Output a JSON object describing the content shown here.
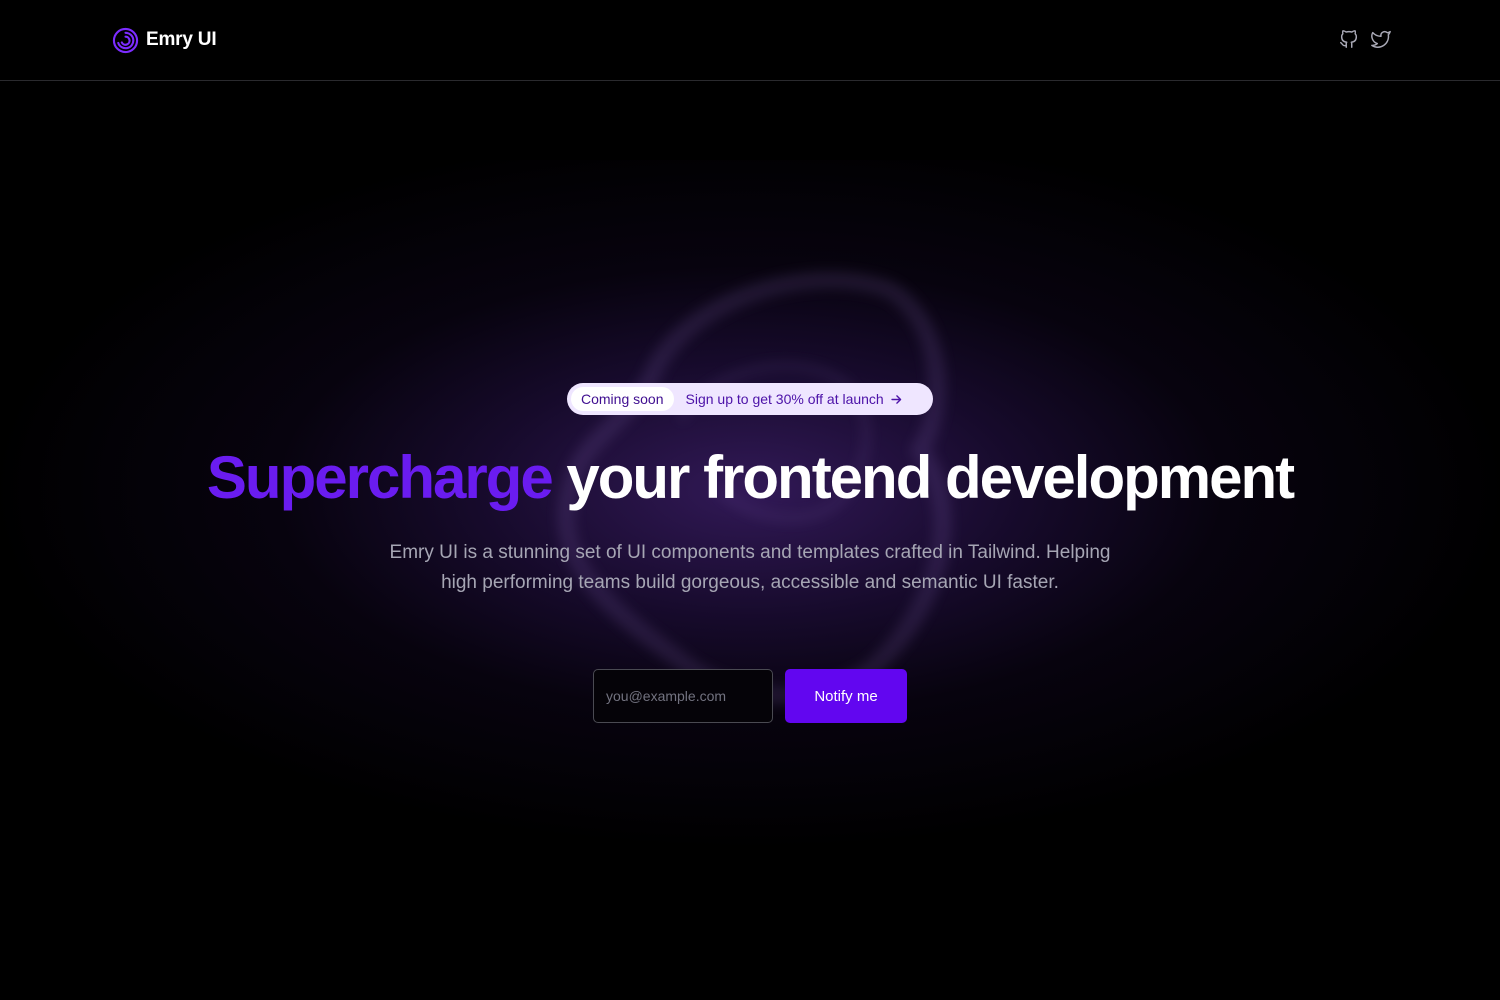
{
  "brand": {
    "name": "Emry UI",
    "logo_icon": "spiral-logo-icon",
    "accent_color": "#6a1cf0"
  },
  "header": {
    "social": [
      {
        "icon": "github-icon"
      },
      {
        "icon": "twitter-icon"
      }
    ]
  },
  "announcement": {
    "badge": "Coming soon",
    "text": "Sign up to get 30% off at launch",
    "icon": "arrow-right-icon"
  },
  "hero": {
    "title_accent": "Supercharge",
    "title_rest": "your frontend development",
    "subtitle": "Emry UI is a stunning set of UI components and templates crafted in Tailwind. Helping high performing teams build gorgeous, accessible and semantic UI faster."
  },
  "signup": {
    "email_value": "",
    "email_placeholder": "you@example.com",
    "button_label": "Notify me",
    "button_color": "#6206f0"
  },
  "colors": {
    "background": "#000000",
    "subtitle_text": "#a6a6b4",
    "pill_background": "#efe6ff"
  }
}
